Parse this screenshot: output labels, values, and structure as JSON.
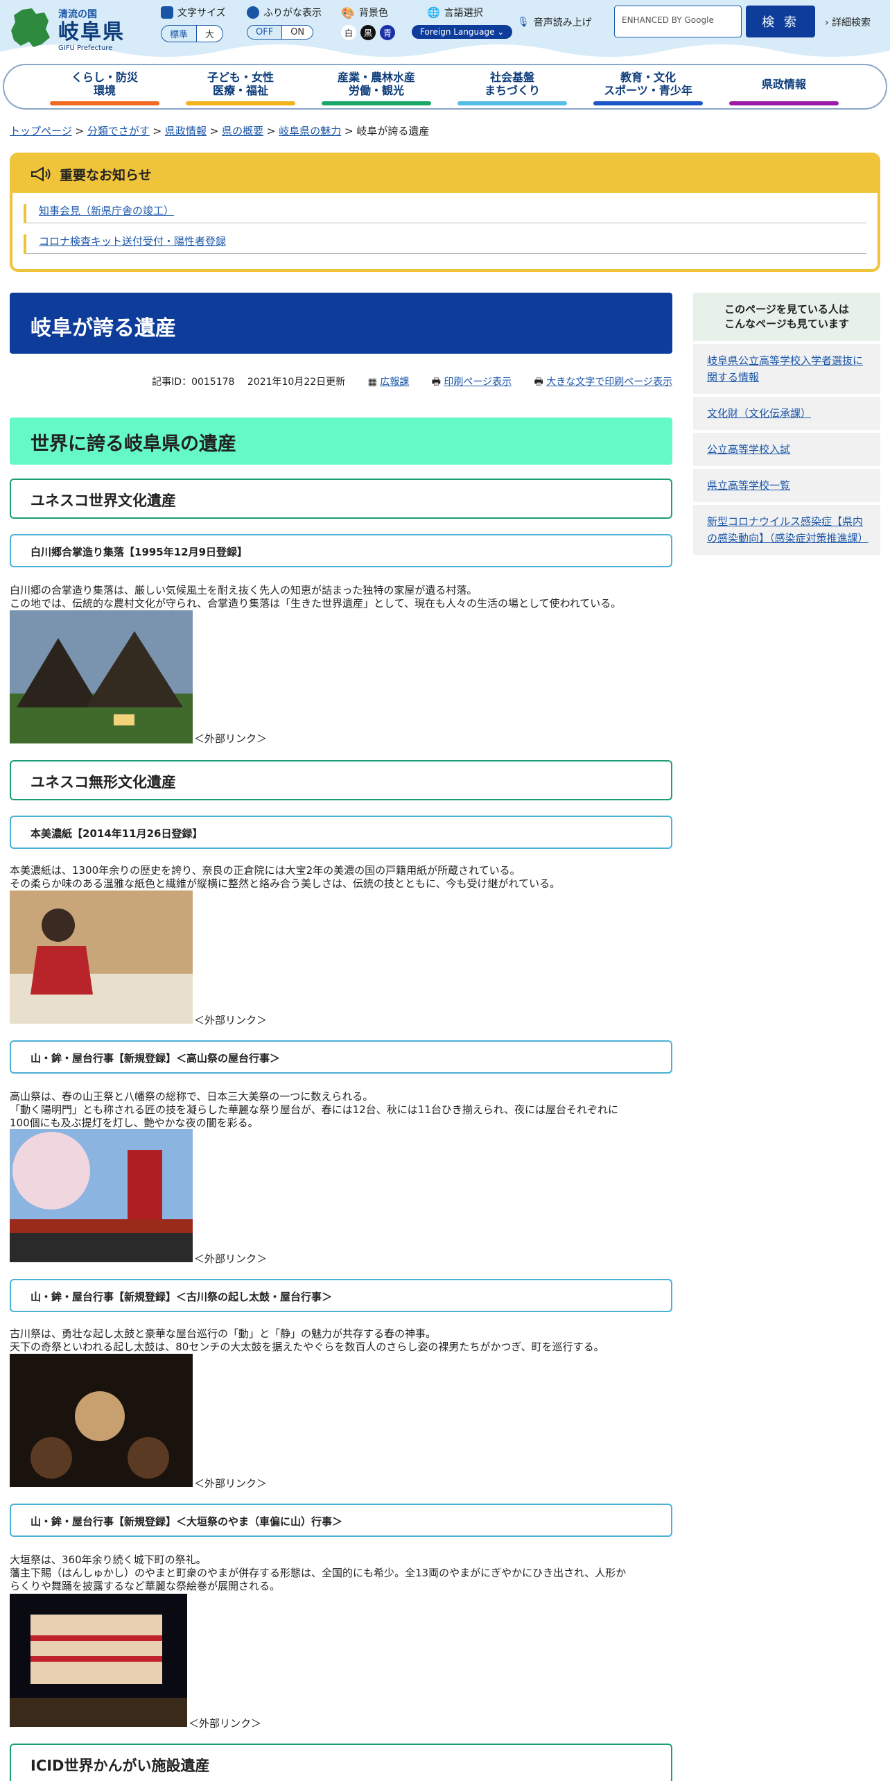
{
  "header": {
    "logo_sub": "清流の国",
    "logo_main": "岐阜県",
    "logo_en": "GIFU Prefecture",
    "font_size_label": "文字サイズ",
    "font_size_options": [
      "標準",
      "大"
    ],
    "furigana_label": "ふりがな表示",
    "furigana_options": [
      "OFF",
      "ON"
    ],
    "bg_label": "背景色",
    "bg_options": [
      "白",
      "黒",
      "青"
    ],
    "lang_label": "言語選択",
    "lang_button": "Foreign Language",
    "speech_label": "音声読み上げ",
    "search_placeholder": "ENHANCED BY Google",
    "search_button": "検 索",
    "advanced_search": "詳細検索"
  },
  "nav": [
    {
      "line1": "くらし・防災",
      "line2": "環境",
      "color": "#f26a21"
    },
    {
      "line1": "子ども・女性",
      "line2": "医療・福祉",
      "color": "#f2b21c"
    },
    {
      "line1": "産業・農林水産",
      "line2": "労働・観光",
      "color": "#1aa668"
    },
    {
      "line1": "社会基盤",
      "line2": "まちづくり",
      "color": "#55bde8"
    },
    {
      "line1": "教育・文化",
      "line2": "スポーツ・青少年",
      "color": "#1a56c8"
    },
    {
      "line1": "県政情報",
      "line2": "",
      "color": "#9b1aa6"
    }
  ],
  "breadcrumb": [
    "トップページ",
    "分類でさがす",
    "県政情報",
    "県の概要",
    "岐阜県の魅力",
    "岐阜が誇る遺産"
  ],
  "notice": {
    "title": "重要なお知らせ",
    "items": [
      "知事会見（新県庁舎の竣工）",
      "コロナ検査キット送付受付・陽性者登録"
    ]
  },
  "main": {
    "title": "岐阜が誇る遺産",
    "meta": {
      "id": "記事ID：0015178",
      "updated": "2021年10月22日更新",
      "dept": "広報課",
      "print": "印刷ページ表示",
      "print_large": "大きな文字で印刷ページ表示"
    },
    "heading": "世界に誇る岐阜県の遺産",
    "sections": [
      {
        "h3": "ユネスコ世界文化遺産"
      },
      {
        "h4": "白川郷合掌造り集落【1995年12月9日登録】",
        "desc": [
          "白川郷の合掌造り集落は、厳しい気候風土を耐え抜く先人の知恵が詰まった独特の家屋が遺る村落。",
          "この地では、伝統的な農村文化が守られ、合掌造り集落は「生きた世界遺産」として、現在も人々の生活の場として使われている。"
        ],
        "link": "＜外部リンク＞"
      },
      {
        "h3": "ユネスコ無形文化遺産"
      },
      {
        "h4": "本美濃紙【2014年11月26日登録】",
        "desc": [
          "本美濃紙は、1300年余りの歴史を誇り、奈良の正倉院には大宝2年の美濃の国の戸籍用紙が所蔵されている。",
          "その柔らか味のある温雅な紙色と繊維が縦横に整然と絡み合う美しさは、伝統の技とともに、今も受け継がれている。"
        ],
        "link": "＜外部リンク＞"
      },
      {
        "h4": "山・鉾・屋台行事【新規登録】＜高山祭の屋台行事＞",
        "desc": [
          "高山祭は、春の山王祭と八幡祭の総称で、日本三大美祭の一つに数えられる。",
          "「動く陽明門」とも称される匠の技を凝らした華麗な祭り屋台が、春には12台、秋には11台ひき揃えられ、夜には屋台それぞれに",
          "100個にも及ぶ提灯を灯し、艶やかな夜の闇を彩る。"
        ],
        "link": "＜外部リンク＞"
      },
      {
        "h4": "山・鉾・屋台行事【新規登録】＜古川祭の起し太鼓・屋台行事＞",
        "desc": [
          "古川祭は、勇壮な起し太鼓と豪華な屋台巡行の「動」と「静」の魅力が共存する春の神事。",
          "天下の奇祭といわれる起し太鼓は、80センチの大太鼓を据えたやぐらを数百人のさらし姿の裸男たちがかつぎ、町を巡行する。"
        ],
        "link": "＜外部リンク＞"
      },
      {
        "h4": "山・鉾・屋台行事【新規登録】＜大垣祭のやま（車偏に山）行事＞",
        "desc": [
          "大垣祭は、360年余り続く城下町の祭礼。",
          "藩主下賜（はんしゅかし）のやまと町衆のやまが併存する形態は、全国的にも希少。全13両のやまがにぎやかにひき出され、人形か",
          "らくりや舞踊を披露するなど華麗な祭絵巻が展開される。"
        ],
        "link": "＜外部リンク＞"
      },
      {
        "h3": "ICID世界かんがい施設遺産"
      }
    ]
  },
  "sidebar": {
    "head": [
      "このページを見ている人は",
      "こんなページも見ています"
    ],
    "items": [
      "岐阜県公立高等学校入学者選抜に関する情報",
      "文化財（文化伝承課）",
      "公立高等学校入試",
      "県立高等学校一覧",
      "新型コロナウイルス感染症【県内の感染動向】（感染症対策推進課）"
    ]
  }
}
